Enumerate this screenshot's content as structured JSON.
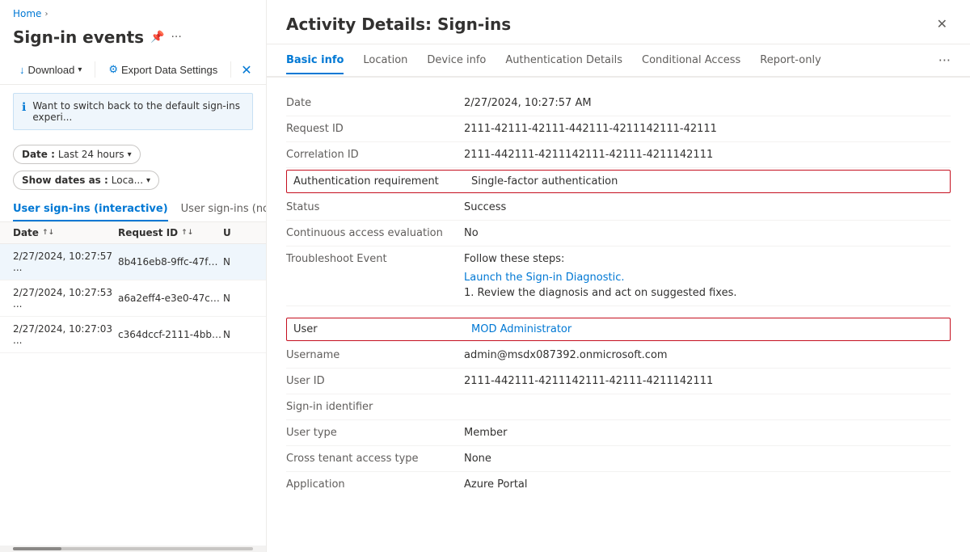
{
  "leftPanel": {
    "breadcrumb": {
      "home": "Home",
      "chevron": "›"
    },
    "title": "Sign-in events",
    "toolbar": {
      "download": "Download",
      "export": "Export Data Settings"
    },
    "infoBanner": "Want to switch back to the default sign-ins experi...",
    "filters": [
      {
        "label": "Date :",
        "value": "Last 24 hours"
      },
      {
        "label": "Show dates as :",
        "value": "Loca..."
      }
    ],
    "tabs": [
      {
        "label": "User sign-ins (interactive)",
        "active": true
      },
      {
        "label": "User sign-ins (non...",
        "active": false
      }
    ],
    "tableHeaders": [
      {
        "label": "Date",
        "sortable": true
      },
      {
        "label": "Request ID",
        "sortable": true
      },
      {
        "label": "U",
        "sortable": false
      }
    ],
    "tableRows": [
      {
        "date": "2/27/2024, 10:27:57 ...",
        "reqId": "8b416eb8-9ffc-47f4-...",
        "user": "N",
        "selected": true
      },
      {
        "date": "2/27/2024, 10:27:53 ...",
        "reqId": "a6a2eff4-e3e0-47ca-...",
        "user": "N",
        "selected": false
      },
      {
        "date": "2/27/2024, 10:27:03 ...",
        "reqId": "c364dccf-2111-4bbd-...",
        "user": "N",
        "selected": false
      }
    ]
  },
  "detailPanel": {
    "title": "Activity Details: Sign-ins",
    "tabs": [
      {
        "label": "Basic info",
        "active": true
      },
      {
        "label": "Location",
        "active": false
      },
      {
        "label": "Device info",
        "active": false
      },
      {
        "label": "Authentication Details",
        "active": false
      },
      {
        "label": "Conditional Access",
        "active": false
      },
      {
        "label": "Report-only",
        "active": false
      }
    ],
    "moreTabsLabel": "...",
    "fields": [
      {
        "label": "Date",
        "value": "2/27/2024, 10:27:57 AM",
        "highlight": false,
        "type": "text"
      },
      {
        "label": "Request ID",
        "value": "2111-42111-42111-442111-4211142111-42111",
        "highlight": false,
        "type": "text"
      },
      {
        "label": "Correlation ID",
        "value": "2111-442111-4211142111-42111-4211142111",
        "highlight": false,
        "type": "text"
      },
      {
        "label": "Authentication requirement",
        "value": "Single-factor authentication",
        "highlight": true,
        "type": "text"
      },
      {
        "label": "Status",
        "value": "Success",
        "highlight": false,
        "type": "text"
      },
      {
        "label": "Continuous access evaluation",
        "value": "No",
        "highlight": false,
        "type": "text"
      },
      {
        "label": "Troubleshoot Event",
        "value": "",
        "highlight": false,
        "type": "troubleshoot",
        "troubleshoot": {
          "steps": "Follow these steps:",
          "link": "Launch the Sign-in Diagnostic.",
          "note": "1. Review the diagnosis and act on suggested fixes."
        }
      },
      {
        "label": "User",
        "value": "MOD Administrator",
        "highlight": true,
        "type": "link"
      },
      {
        "label": "Username",
        "value": "admin@msdx087392.onmicrosoft.com",
        "highlight": false,
        "type": "text"
      },
      {
        "label": "User ID",
        "value": "2111-442111-4211142111-42111-4211142111",
        "highlight": false,
        "type": "text"
      },
      {
        "label": "Sign-in identifier",
        "value": "",
        "highlight": false,
        "type": "text"
      },
      {
        "label": "User type",
        "value": "Member",
        "highlight": false,
        "type": "text"
      },
      {
        "label": "Cross tenant access type",
        "value": "None",
        "highlight": false,
        "type": "text"
      },
      {
        "label": "Application",
        "value": "Azure Portal",
        "highlight": false,
        "type": "text"
      }
    ]
  }
}
